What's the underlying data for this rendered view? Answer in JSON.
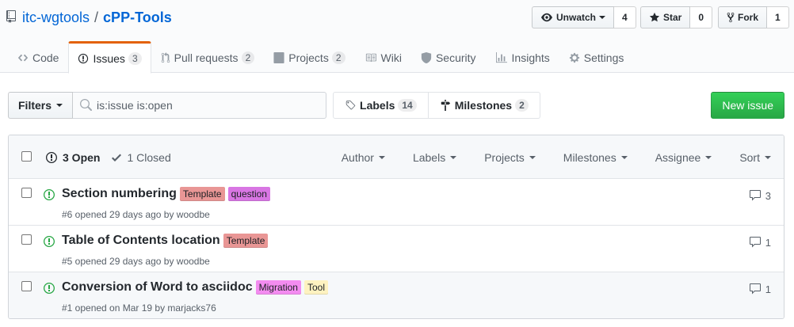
{
  "repo": {
    "owner": "itc-wgtools",
    "separator": "/",
    "name": "cPP-Tools"
  },
  "actions": {
    "watch": {
      "label": "Unwatch",
      "count": "4"
    },
    "star": {
      "label": "Star",
      "count": "0"
    },
    "fork": {
      "label": "Fork",
      "count": "1"
    }
  },
  "nav": {
    "code": "Code",
    "issues": "Issues",
    "issues_count": "3",
    "pulls": "Pull requests",
    "pulls_count": "2",
    "projects": "Projects",
    "projects_count": "2",
    "wiki": "Wiki",
    "security": "Security",
    "insights": "Insights",
    "settings": "Settings"
  },
  "subnav": {
    "filters": "Filters",
    "search_value": "is:issue is:open",
    "labels": "Labels",
    "labels_count": "14",
    "milestones": "Milestones",
    "milestones_count": "2",
    "new_issue": "New issue"
  },
  "list_header": {
    "open": "3 Open",
    "closed": "1 Closed",
    "menus": [
      "Author",
      "Labels",
      "Projects",
      "Milestones",
      "Assignee",
      "Sort"
    ]
  },
  "issues": [
    {
      "title": "Section numbering",
      "labels": [
        {
          "name": "Template",
          "color": "#e99695"
        },
        {
          "name": "question",
          "color": "#d876e3"
        }
      ],
      "meta": "#6 opened 29 days ago by woodbe",
      "comments": "3"
    },
    {
      "title": "Table of Contents location",
      "labels": [
        {
          "name": "Template",
          "color": "#e99695"
        }
      ],
      "meta": "#5 opened 29 days ago by woodbe",
      "comments": "1"
    },
    {
      "title": "Conversion of Word to asciidoc",
      "labels": [
        {
          "name": "Migration",
          "color": "#f38cf0"
        },
        {
          "name": "Tool",
          "color": "#fef2c0"
        }
      ],
      "meta": "#1 opened on Mar 19 by marjacks76",
      "comments": "1"
    }
  ],
  "colors": {
    "link": "#0366d6",
    "open_issue": "#28a745",
    "selected_tab_border": "#e36209",
    "primary_button": "#28a745"
  }
}
